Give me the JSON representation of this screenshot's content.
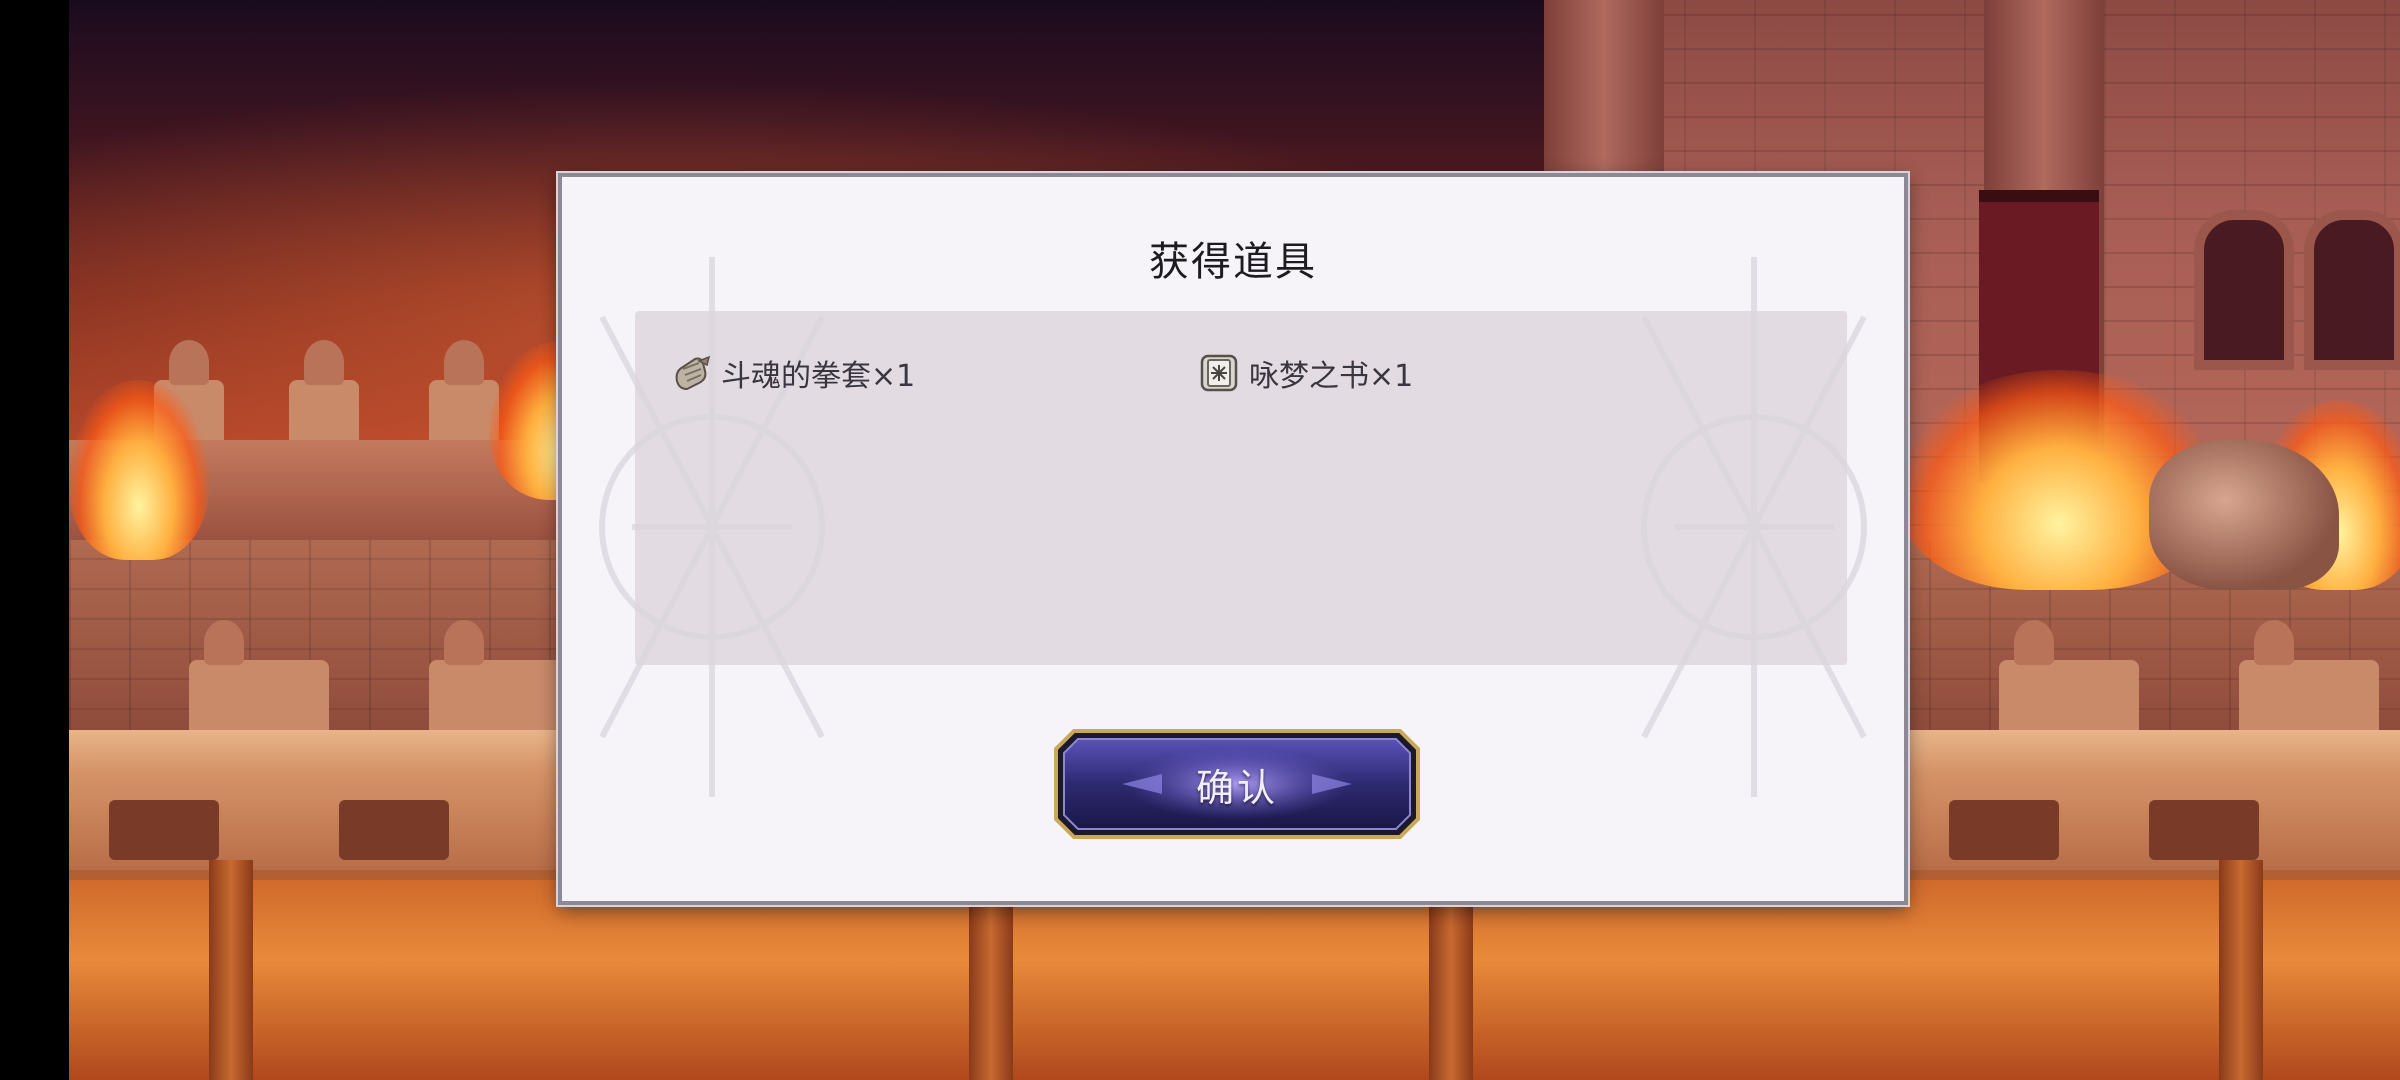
{
  "dialog": {
    "title": "获得道具",
    "items": [
      {
        "icon": "gauntlet-icon",
        "label": "斗魂的拳套×1"
      },
      {
        "icon": "book-icon",
        "label": "咏梦之书×1"
      }
    ],
    "confirm_label": "确认"
  },
  "colors": {
    "dialog_bg": "#f6f4f8",
    "panel_bg": "#dad2da",
    "button_fill": "#2e2a70",
    "button_border": "#c9a85a"
  }
}
